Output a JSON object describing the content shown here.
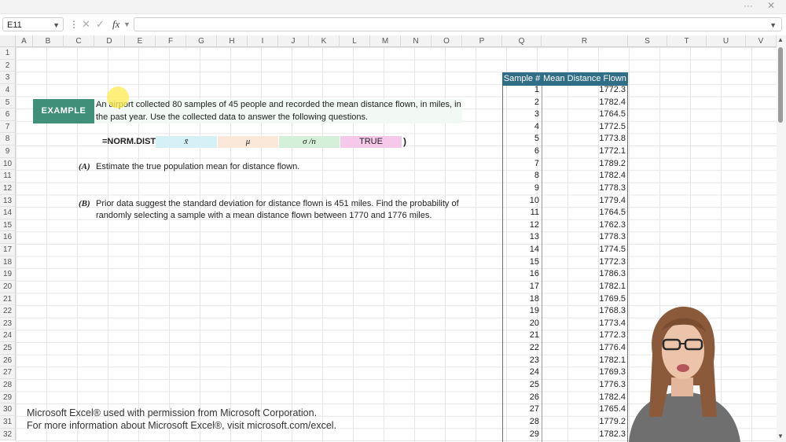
{
  "window": {
    "controls": [
      "···",
      "✕"
    ]
  },
  "formula_bar": {
    "name_box": "E11",
    "dots": "⋮",
    "cancel_icon": "✕",
    "enter_icon": "✓",
    "fx_label": "fx",
    "formula_value": ""
  },
  "columns": [
    "A",
    "B",
    "C",
    "D",
    "E",
    "F",
    "G",
    "H",
    "I",
    "J",
    "K",
    "L",
    "M",
    "N",
    "O",
    "P",
    "Q",
    "R",
    "S",
    "T",
    "U",
    "V"
  ],
  "rows": [
    "1",
    "2",
    "3",
    "4",
    "5",
    "6",
    "7",
    "8",
    "9",
    "10",
    "11",
    "12",
    "13",
    "14",
    "15",
    "16",
    "17",
    "18",
    "19",
    "20",
    "21",
    "22",
    "23",
    "24",
    "25",
    "26",
    "27",
    "28",
    "29",
    "30",
    "31",
    "32"
  ],
  "example": {
    "label": "EXAMPLE",
    "line1": "An airport collected 80 samples of 45 people and recorded the mean distance flown, in miles, in",
    "line2": "the past year. Use the collected data to answer the following questions."
  },
  "formula": {
    "prefix": "=NORM.DIST(",
    "args": [
      {
        "text": "x̄",
        "color": "#d6f0f7"
      },
      {
        "text": "μ",
        "color": "#fbe8d8"
      },
      {
        "text": "σ /n",
        "color": "#d5f0d8"
      },
      {
        "text": "TRUE",
        "color": "#f6c8ea"
      }
    ],
    "suffix": ")"
  },
  "questions": {
    "a_label": "(A)",
    "a_text": "Estimate the true population mean for distance flown.",
    "b_label": "(B)",
    "b_line1": "Prior data suggest the standard deviation for distance flown is 451 miles. Find the probability of",
    "b_line2": "randomly selecting a sample with a mean distance flown between 1770 and 1776 miles."
  },
  "table": {
    "headers": [
      "Sample #",
      "Mean Distance Flown"
    ],
    "header_color": "#2f6e86",
    "rows": [
      [
        "1",
        "1772.3"
      ],
      [
        "2",
        "1782.4"
      ],
      [
        "3",
        "1764.5"
      ],
      [
        "4",
        "1772.5"
      ],
      [
        "5",
        "1773.8"
      ],
      [
        "6",
        "1772.1"
      ],
      [
        "7",
        "1789.2"
      ],
      [
        "8",
        "1782.4"
      ],
      [
        "9",
        "1778.3"
      ],
      [
        "10",
        "1779.4"
      ],
      [
        "11",
        "1764.5"
      ],
      [
        "12",
        "1762.3"
      ],
      [
        "13",
        "1778.3"
      ],
      [
        "14",
        "1774.5"
      ],
      [
        "15",
        "1772.3"
      ],
      [
        "16",
        "1786.3"
      ],
      [
        "17",
        "1782.1"
      ],
      [
        "18",
        "1769.5"
      ],
      [
        "19",
        "1768.3"
      ],
      [
        "20",
        "1773.4"
      ],
      [
        "21",
        "1772.3"
      ],
      [
        "22",
        "1776.4"
      ],
      [
        "23",
        "1782.1"
      ],
      [
        "24",
        "1769.3"
      ],
      [
        "25",
        "1776.3"
      ],
      [
        "26",
        "1782.4"
      ],
      [
        "27",
        "1765.4"
      ],
      [
        "28",
        "1779.2"
      ],
      [
        "29",
        "1782.3"
      ]
    ]
  },
  "notice": {
    "line1": "Microsoft Excel® used with permission from Microsoft Corporation.",
    "line2": "For more information about Microsoft Excel®, visit microsoft.com/excel."
  }
}
